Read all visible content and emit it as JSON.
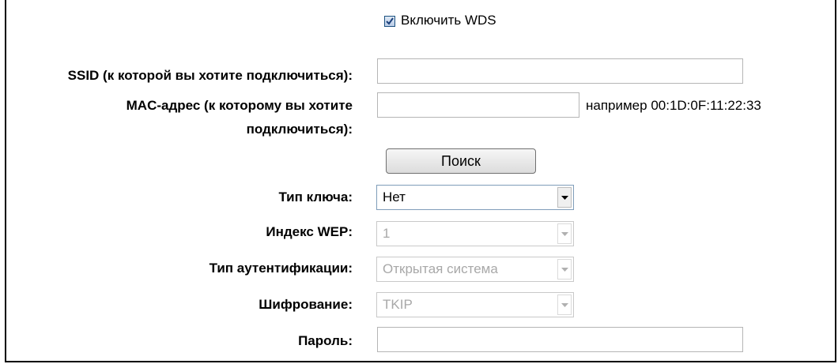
{
  "wds": {
    "enable_label": "Включить WDS",
    "enabled": true
  },
  "fields": {
    "ssid": {
      "label": "SSID (к которой вы хотите подключиться):",
      "value": ""
    },
    "mac": {
      "label_line1": "MAC-адрес (к которому вы хотите",
      "label_line2": "подключиться):",
      "value": "",
      "hint": "например 00:1D:0F:11:22:33"
    },
    "search_button": "Поиск",
    "key_type": {
      "label": "Тип ключа:",
      "value": "Нет"
    },
    "wep_index": {
      "label": "Индекс WEP:",
      "value": "1"
    },
    "auth_type": {
      "label": "Тип аутентификации:",
      "value": "Открытая система"
    },
    "encryption": {
      "label": "Шифрование:",
      "value": "TKIP"
    },
    "password": {
      "label": "Пароль:",
      "value": ""
    }
  }
}
